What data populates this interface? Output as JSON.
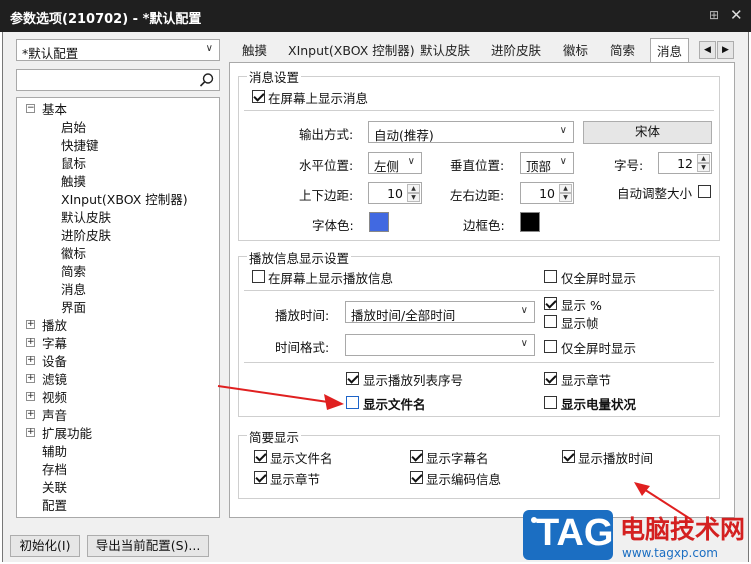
{
  "window": {
    "title": "参数选项(210702) - *默认配置",
    "pin_glyph": "⊞",
    "close_glyph": "✕"
  },
  "preset": {
    "value": "*默认配置"
  },
  "search": {
    "placeholder": ""
  },
  "tree": {
    "root": "基本",
    "children": [
      "启始",
      "快捷键",
      "鼠标",
      "触摸",
      "XInput(XBOX 控制器)",
      "默认皮肤",
      "进阶皮肤",
      "徽标",
      "简索",
      "消息",
      "界面"
    ],
    "collapsed": [
      "播放",
      "字幕",
      "设备",
      "滤镜",
      "视频",
      "声音",
      "扩展功能"
    ],
    "leaves": [
      "辅助",
      "存档",
      "关联",
      "配置"
    ]
  },
  "tabs": [
    "触摸",
    "XInput(XBOX 控制器)",
    "默认皮肤",
    "进阶皮肤",
    "徽标",
    "简索",
    "消息"
  ],
  "tab_nav": {
    "left": "◀",
    "right": "▶"
  },
  "message_settings": {
    "group_title": "消息设置",
    "show_on_screen": "在屏幕上显示消息",
    "output_label": "输出方式:",
    "output_value": "自动(推荐)",
    "font_button": "宋体",
    "hpos_label": "水平位置:",
    "hpos_value": "左侧",
    "vpos_label": "垂直位置:",
    "vpos_value": "顶部",
    "size_label": "字号:",
    "size_value": "12",
    "vmargin_label": "上下边距:",
    "vmargin_value": "10",
    "hmargin_label": "左右边距:",
    "hmargin_value": "10",
    "autosize_label": "自动调整大小",
    "fontcolor_label": "字体色:",
    "bordercolor_label": "边框色:",
    "font_color": "#4169e1",
    "border_color": "#000000"
  },
  "playback_info": {
    "group_title": "播放信息显示设置",
    "show_play_info": "在屏幕上显示播放信息",
    "fullscreen_only_1": "仅全屏时显示",
    "play_time_label": "播放时间:",
    "play_time_value": "播放时间/全部时间",
    "show_percent": "显示 %",
    "show_frame": "显示帧",
    "time_format_label": "时间格式:",
    "time_format_value": "",
    "fullscreen_only_2": "仅全屏时显示",
    "show_playlist_index": "显示播放列表序号",
    "show_chapter": "显示章节",
    "show_filename": "显示文件名",
    "show_battery": "显示电量状况"
  },
  "brief": {
    "group_title": "简要显示",
    "show_filename": "显示文件名",
    "show_subtitle_name": "显示字幕名",
    "show_play_time": "显示播放时间",
    "show_chapter": "显示章节",
    "show_codec_info": "显示编码信息"
  },
  "bottom": {
    "init_button": "初始化(I)",
    "export_button": "导出当前配置(S)..."
  },
  "watermark": {
    "tag": "TAG",
    "site": "电脑技术网",
    "url": "www.tagxp.com"
  },
  "colors": {
    "accent": "#1e64c8",
    "arrow": "#e02020",
    "tag_bg": "#1b6ec2"
  }
}
